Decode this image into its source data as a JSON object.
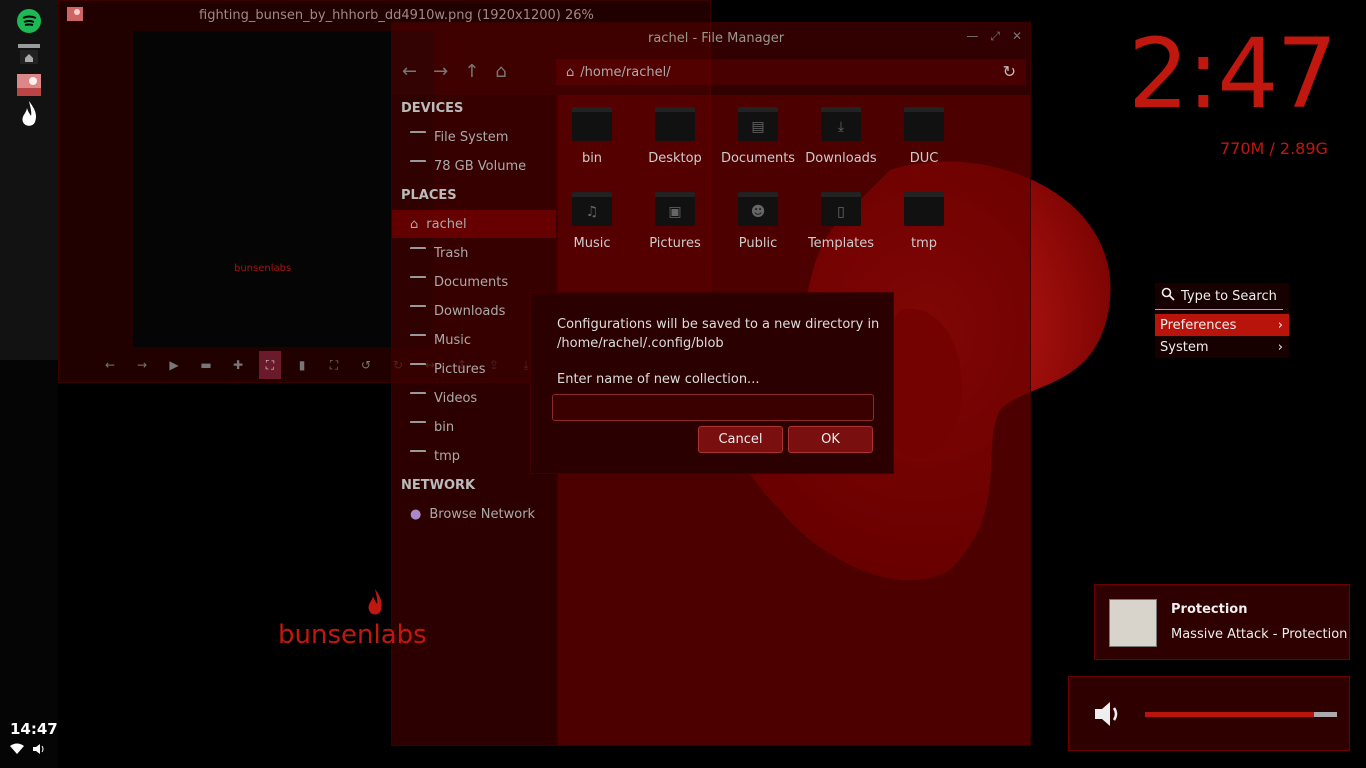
{
  "desktop": {
    "big_clock": "2:47",
    "memory": "770M / 2.89G",
    "logo_text": "bunsenlabs",
    "viewer_logo_text": "bunsenlabs"
  },
  "panel": {
    "time": "14:47",
    "apps": [
      "spotify-icon",
      "file-manager-icon",
      "image-viewer-icon",
      "bunsenlabs-flame-icon"
    ]
  },
  "image_viewer": {
    "title": "fighting_bunsen_by_hhhorb_dd4910w.png (1920x1200) 26%"
  },
  "file_manager": {
    "title": "rachel - File Manager",
    "path": "/home/rachel/",
    "sidebar": {
      "devices_header": "DEVICES",
      "devices": [
        "File System",
        "78 GB Volume"
      ],
      "places_header": "PLACES",
      "places": [
        "rachel",
        "Trash",
        "Documents",
        "Downloads",
        "Music",
        "Pictures",
        "Videos",
        "bin",
        "tmp"
      ],
      "network_header": "NETWORK",
      "network": [
        "Browse Network"
      ]
    },
    "folders": [
      "bin",
      "Desktop",
      "Documents",
      "Downloads",
      "DUC",
      "Music",
      "Pictures",
      "Public",
      "Templates",
      "tmp"
    ]
  },
  "dialog": {
    "message_line1": "Configurations will be saved to a new directory in",
    "message_line2": "/home/rachel/.config/blob",
    "prompt": "Enter name of new collection...",
    "input_value": "",
    "cancel_label": "Cancel",
    "ok_label": "OK"
  },
  "menu": {
    "search_placeholder": "Type to Search",
    "items": [
      "Preferences",
      "System"
    ]
  },
  "notification": {
    "title": "Protection",
    "body": "Massive Attack - Protection"
  },
  "volume": {
    "level": 0.88
  }
}
